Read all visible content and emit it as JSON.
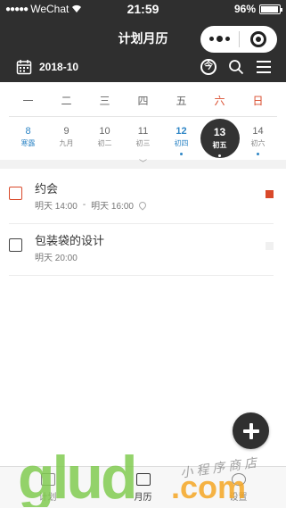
{
  "status_bar": {
    "signal": "●●●●●",
    "carrier": "WeChat",
    "time": "21:59",
    "battery": "96%"
  },
  "navbar": {
    "title": "计划月历"
  },
  "toolbar": {
    "month": "2018-10",
    "today_label": "今"
  },
  "weekdays": [
    "一",
    "二",
    "三",
    "四",
    "五",
    "六",
    "日"
  ],
  "days": [
    {
      "num": "8",
      "lunar": "寒露",
      "style": "blue",
      "dot": false
    },
    {
      "num": "9",
      "lunar": "九月",
      "style": "",
      "dot": false
    },
    {
      "num": "10",
      "lunar": "初二",
      "style": "",
      "dot": false
    },
    {
      "num": "11",
      "lunar": "初三",
      "style": "",
      "dot": false
    },
    {
      "num": "12",
      "lunar": "初四",
      "style": "blue bold",
      "dot": true
    },
    {
      "num": "13",
      "lunar": "初五",
      "style": "selected",
      "dot": true
    },
    {
      "num": "14",
      "lunar": "初六",
      "style": "",
      "dot": true
    }
  ],
  "collapse_icon": "﹀",
  "items": [
    {
      "title": "约会",
      "start": "明天 14:00",
      "sep": "-",
      "end": "明天 16:00",
      "has_location": true,
      "check_color": "#d9492a",
      "flag_color": "#d9492a"
    },
    {
      "title": "包装袋的设计",
      "start": "明天 20:00",
      "sep": "",
      "end": "",
      "has_location": false,
      "check_color": "#444444",
      "flag_color": "#f0f0f0"
    }
  ],
  "tabs": [
    {
      "label": "计划",
      "active": false
    },
    {
      "label": "月历",
      "active": true
    },
    {
      "label": "设置",
      "active": false
    }
  ],
  "watermark": {
    "brand": "glud",
    "domain": ".com",
    "slogan": "小程序商店"
  },
  "colors": {
    "header_bg": "#2f2f2f",
    "accent_blue": "#2f86c6",
    "accent_red": "#d9492a",
    "wm_green": "#7cc94b",
    "wm_orange": "#f5a623"
  }
}
